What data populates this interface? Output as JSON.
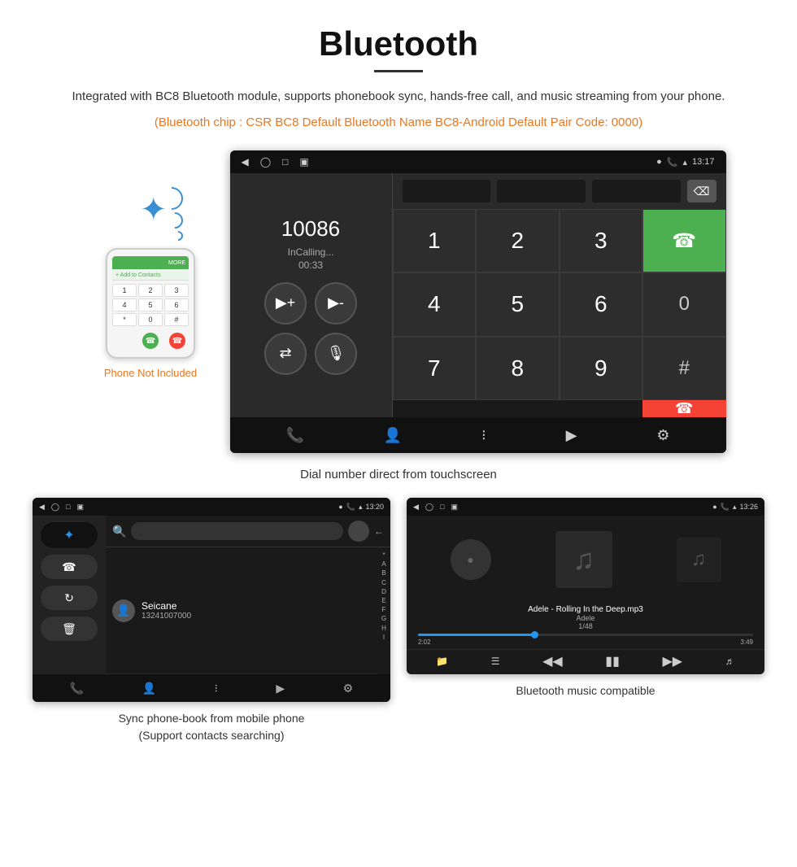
{
  "page": {
    "title": "Bluetooth",
    "description": "Integrated with BC8 Bluetooth module, supports phonebook sync, hands-free call, and music streaming from your phone.",
    "orange_note": "(Bluetooth chip : CSR BC8    Default Bluetooth Name BC8-Android    Default Pair Code: 0000)"
  },
  "dial_screen": {
    "time": "13:17",
    "number": "10086",
    "status": "InCalling...",
    "timer": "00:33",
    "keys": [
      "1",
      "2",
      "3",
      "*",
      "4",
      "5",
      "6",
      "0",
      "7",
      "8",
      "9",
      "#"
    ],
    "caption": "Dial number direct from touchscreen"
  },
  "phonebook_screen": {
    "time": "13:20",
    "contact_name": "Seicane",
    "contact_phone": "13241007000",
    "alpha_letters": [
      "*",
      "A",
      "B",
      "C",
      "D",
      "E",
      "F",
      "G",
      "H",
      "I"
    ],
    "caption_line1": "Sync phone-book from mobile phone",
    "caption_line2": "(Support contacts searching)"
  },
  "music_screen": {
    "time": "13:26",
    "song_title": "Adele - Rolling In the Deep.mp3",
    "artist": "Adele",
    "track_count": "1/48",
    "time_current": "2:02",
    "time_total": "3:49",
    "caption": "Bluetooth music compatible"
  },
  "phone_mockup": {
    "keys": [
      "1",
      "2",
      "3",
      "4",
      "5",
      "6",
      "*",
      "0",
      "#"
    ],
    "not_included": "Phone Not Included"
  }
}
